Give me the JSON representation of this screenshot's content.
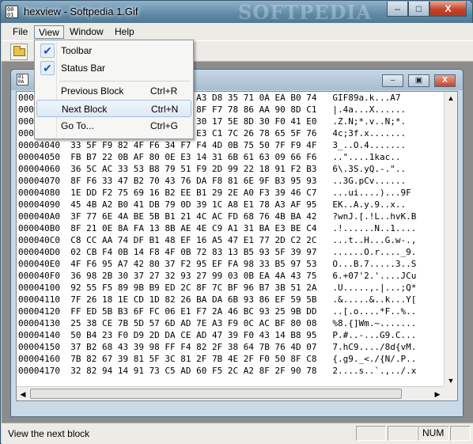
{
  "window": {
    "title": "hexview - Softpedia 1.Gif",
    "watermark": "SOFTPEDIA",
    "minimize": "–",
    "maximize": "□",
    "close": "X"
  },
  "menubar": {
    "items": [
      "File",
      "View",
      "Window",
      "Help"
    ]
  },
  "view_menu": {
    "toolbar_label": "Toolbar",
    "statusbar_label": "Status Bar",
    "prev_label": "Previous Block",
    "prev_shortcut": "Ctrl+R",
    "next_label": "Next Block",
    "next_shortcut": "Ctrl+N",
    "goto_label": "Go To...",
    "goto_shortcut": "Ctrl+G",
    "check": "✔"
  },
  "child": {
    "minimize": "–",
    "restore": "▣",
    "close": "X"
  },
  "hex_rows": [
    "00004000  47 49 46 38 39 61 41 54 A3 D8 35 71 0A EA B0 74   GIF89a.k...A7",
    "00004010  7C 9E 34 61 F3 EF EF 38 8F F7 78 86 AA 90 8D C1   |.4a...X......",
    "00004020  2E 5A 8E 4E 3B 2A 2A 84 30 17 5E 8D 30 F0 41 E0   .Z.N;*.v..N;*.",
    "00004030  34 63 3B 66 2E 78 78 86 E3 C1 7C 26 78 65 5F 76   4c;3f.x.......",
    "00004040  33 5F F9 82 4F F6 34 F7 F4 4D 0B 75 50 7F F9 4F   3_..O.4.......",
    "00004050  FB B7 22 0B AF 80 0E E3 14 31 6B 61 63 09 66 F6   ..\"....1kac..",
    "00004060  36 5C AC 33 53 B8 79 51 F9 2D 99 22 18 91 F2 B3   6\\.3S.yQ.-.\"..",
    "00004070  8F F6 33 47 B2 70 43 76 DA F8 81 6E 9F B3 95 93   ..3G.pCv......",
    "00004080  1E DD F2 75 69 16 B2 EE B1 29 2E A0 F3 39 46 C7   ...ui....)...9F",
    "00004090  45 4B A2 B0 41 DB 79 0D 39 1C A8 E1 78 A3 AF 95   EK..A.y.9..x..",
    "000040A0  3F 77 6E 4A BE 5B B1 21 4C AC FD 68 76 4B BA 42   ?wnJ.[.!L..hvK.B",
    "000040B0  8F 21 0E 8A FA 13 8B AE 4E C9 A1 31 BA E3 BE C4   .!......N..1....",
    "000040C0  C8 CC AA 74 DF B1 48 EF 16 A5 47 E1 77 2D C2 2C   ...t..H...G.w-.,",
    "000040D0  02 CB F4 0B 14 F8 4F 0B 72 83 13 B5 93 5F 39 97   ......O.r...._9.",
    "000040E0  4F F6 95 A7 42 80 37 F2 95 EF FA 98 33 B5 97 53   O...B.7.....3..S",
    "000040F0  36 98 2B 30 37 27 32 93 27 99 03 0B EA 4A 43 75   6.+07'2.'....JCu",
    "00004100  92 55 F5 89 9B B9 ED 2C 8F 7C BF 96 B7 3B 51 2A   .U.....,.|...;Q*",
    "00004110  7F 26 18 1E CD 1D 82 26 BA DA 6B 93 86 EF 59 5B   .&.....&..k...Y[",
    "00004120  FF ED 5B B3 6F FC 06 E1 F7 2A 46 BC 93 25 9B DD   ..[.o....*F..%..",
    "00004130  25 38 CE 7B 5D 57 6D AD 7E A3 F9 0C AC BF 80 08   %8.{]Wm.~.......",
    "00004140  50 B4 23 F0 D9 2D DA CE AD 47 39 F0 43 14 B8 95   P.#..-...G9.C...",
    "00004150  37 B2 68 43 39 98 FF F4 82 2F 38 64 7B 76 4D 07   7.hC9..../8d{vM.",
    "00004160  7B 82 67 39 81 5F 3C 81 2F 7B 4E 2F F0 50 8F C8   {.g9._<./{N/.P..",
    "00004170  32 82 94 14 91 73 C5 AD 60 F5 2C A2 8F 2F 90 78   2....s..`.,../.x"
  ],
  "status": {
    "text": "View the next block",
    "num": "NUM"
  },
  "colors": {
    "titlebar": "#5f8aa6",
    "menu_bg": "#ecebe6",
    "highlight": "#dde9f4",
    "check": "#1e56b8"
  }
}
